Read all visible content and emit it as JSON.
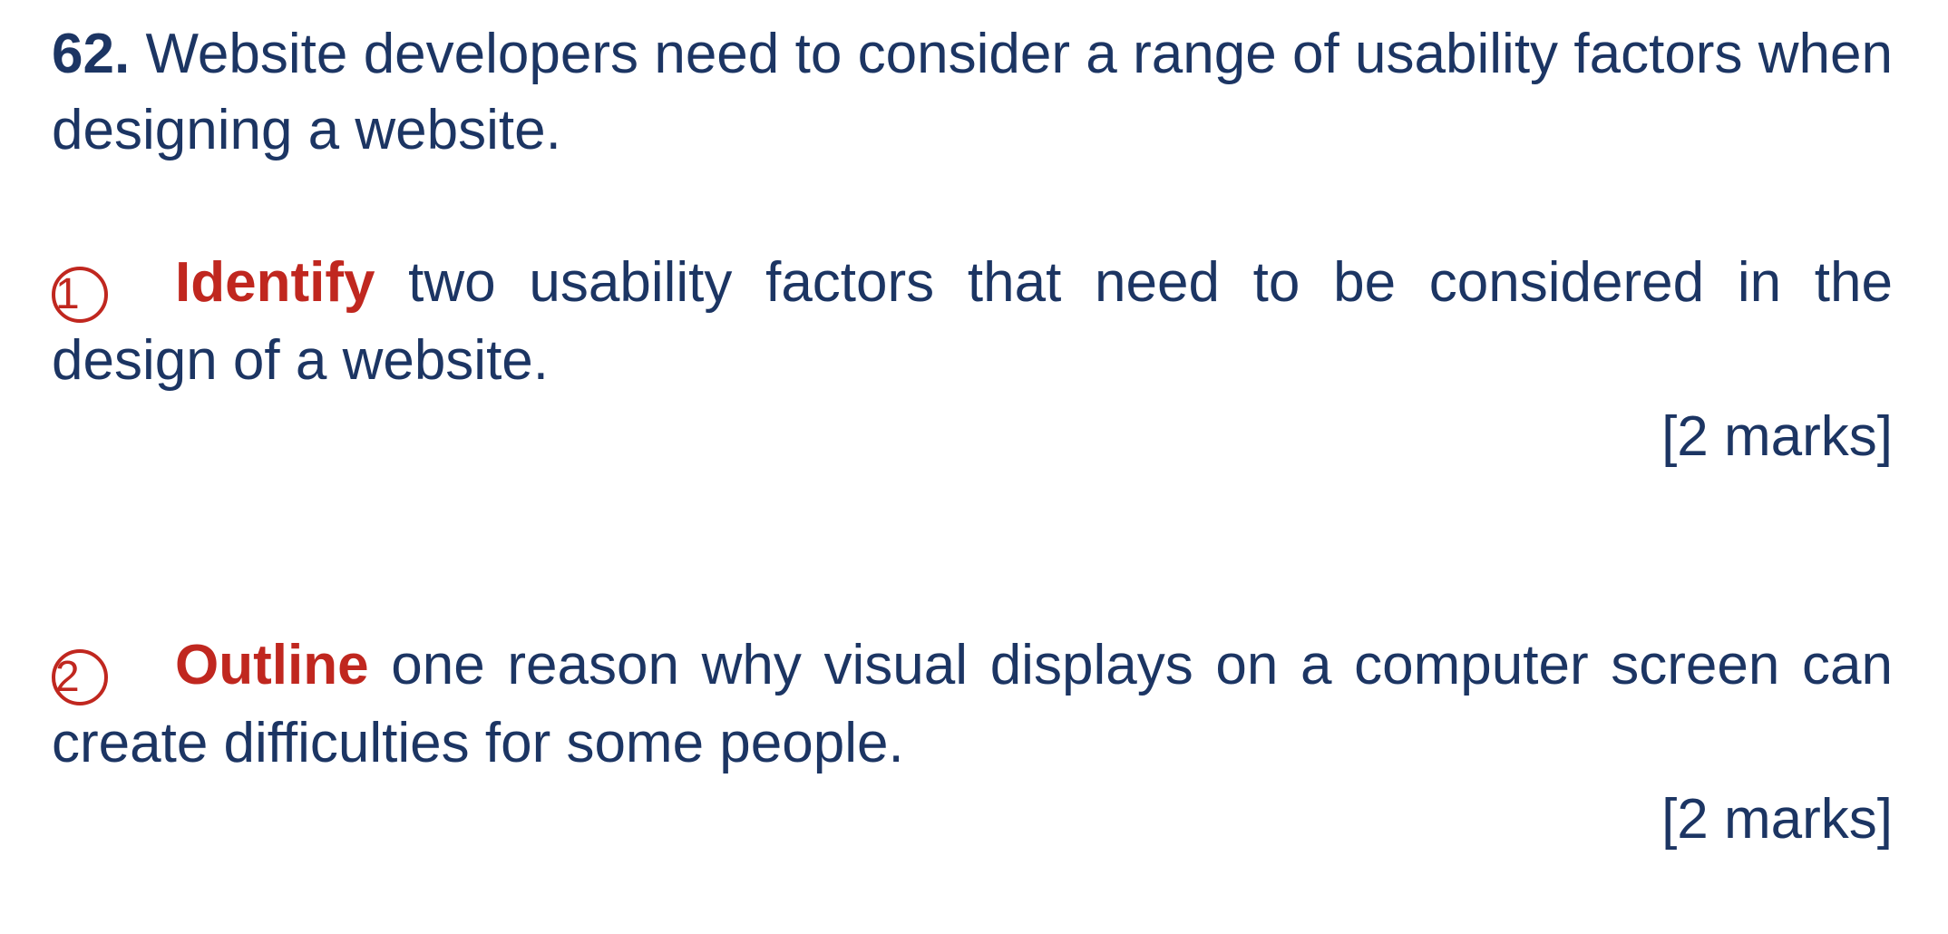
{
  "question": {
    "number": "62.",
    "stem": " Website developers need to consider a range of usability factors when designing a website."
  },
  "parts": [
    {
      "marker": "1",
      "command": "Identify",
      "text": " two usability factors that need to be considered in the design of a website.",
      "marks": "[2 marks]"
    },
    {
      "marker": "2",
      "command": "Outline",
      "text": " one reason why visual displays on a computer screen can create difficulties for some people.",
      "marks": "[2 marks]"
    }
  ],
  "colors": {
    "text": "#1c3563",
    "accent": "#c0271f",
    "background": "#ffffff"
  }
}
